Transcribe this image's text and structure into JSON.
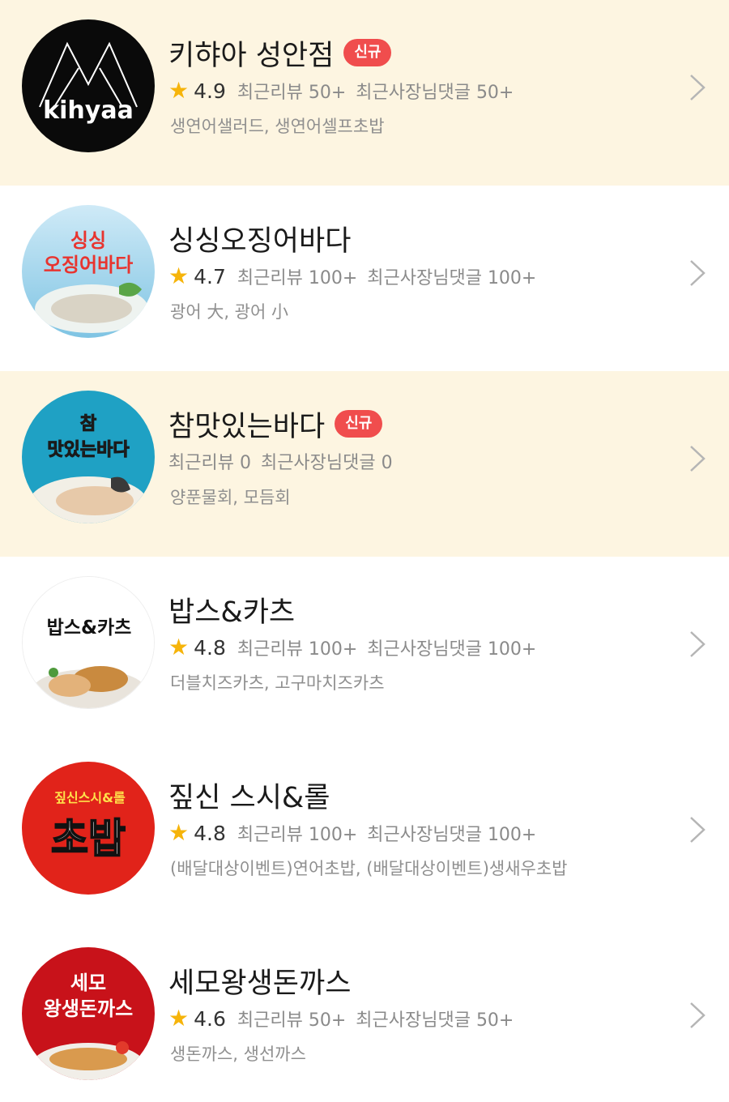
{
  "stores": [
    {
      "name": "키햐아 성안점",
      "badge": "신규",
      "rating_star": "★",
      "rating": "4.9",
      "recent_reviews": "최근리뷰 50+",
      "owner_replies": "최근사장님댓글 50+",
      "menu": "생연어샐러드, 생연어셀프초밥",
      "logo_text": "kihyaa",
      "highlighted": true
    },
    {
      "name": "싱싱오징어바다",
      "badge": "",
      "rating_star": "★",
      "rating": "4.7",
      "recent_reviews": "최근리뷰 100+",
      "owner_replies": "최근사장님댓글 100+",
      "menu": "광어 大, 광어 小",
      "logo_line1": "싱싱",
      "logo_line2": "오징어바다",
      "highlighted": false
    },
    {
      "name": "참맛있는바다",
      "badge": "신규",
      "rating_star": "",
      "rating": "",
      "recent_reviews": "최근리뷰 0",
      "owner_replies": "최근사장님댓글 0",
      "menu": "양푼물회, 모듬회",
      "logo_line1": "참",
      "logo_line2": "맛있는바다",
      "highlighted": true
    },
    {
      "name": "밥스&카츠",
      "badge": "",
      "rating_star": "★",
      "rating": "4.8",
      "recent_reviews": "최근리뷰 100+",
      "owner_replies": "최근사장님댓글 100+",
      "menu": "더블치즈카츠, 고구마치즈카츠",
      "logo_text": "밥스&카츠",
      "highlighted": false
    },
    {
      "name": "짚신 스시&롤",
      "badge": "",
      "rating_star": "★",
      "rating": "4.8",
      "recent_reviews": "최근리뷰 100+",
      "owner_replies": "최근사장님댓글 100+",
      "menu": "(배달대상이벤트)연어초밥, (배달대상이벤트)생새우초밥",
      "logo_line1": "짚신스시&롤",
      "logo_line2": "초밥",
      "highlighted": false
    },
    {
      "name": "세모왕생돈까스",
      "badge": "",
      "rating_star": "★",
      "rating": "4.6",
      "recent_reviews": "최근리뷰 50+",
      "owner_replies": "최근사장님댓글 50+",
      "menu": "생돈까스, 생선까스",
      "logo_line1": "세모",
      "logo_line2": "왕생돈까스",
      "highlighted": false
    }
  ],
  "colors": {
    "highlight_bg": "#fdf5e1",
    "badge_bg": "#f04d4d",
    "star": "#f6b40a",
    "meta_text": "#8a8a8a"
  },
  "icons": {
    "row_arrow": "chevron-right-icon",
    "rating": "star-icon"
  }
}
